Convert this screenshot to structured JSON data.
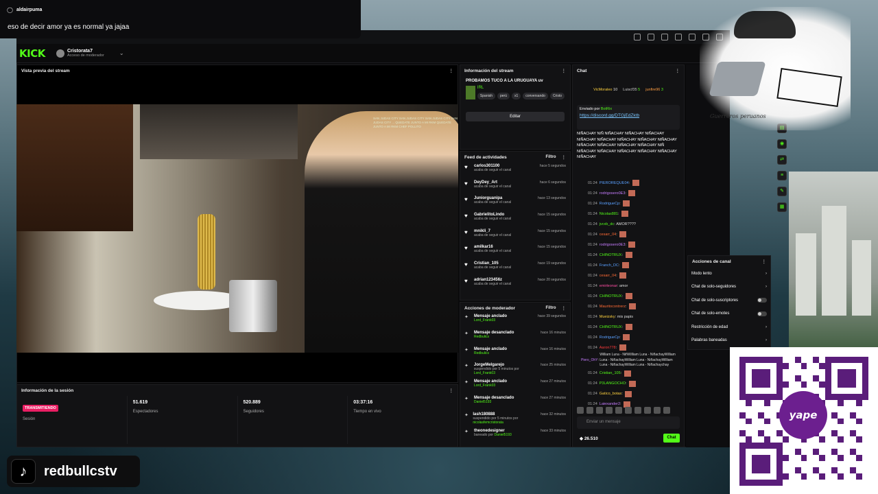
{
  "notification": {
    "username": "aldairpuma",
    "message": "eso de decir amor ya es normal ya jajaa"
  },
  "header": {
    "logo": "KICK",
    "channel_name": "Cristorata7",
    "channel_role": "Acceso de moderador"
  },
  "preview": {
    "title": "Vista previa del stream",
    "overlay_text": "SAN JUDAS CITY SAN JUDAS CITY SAN JUDAS CITY SAN JUDAS CITY ... QUEDATE JUNTO A MI RKM QUEDATE JUNTO A MI RKM CHEF POLLITO"
  },
  "session": {
    "title": "Información de la sesión",
    "cells": [
      {
        "value": "TRANSMITIENDO",
        "label": "Sesión"
      },
      {
        "value": "51.619",
        "label": "Espectadores"
      },
      {
        "value": "520.889",
        "label": "Seguidores"
      },
      {
        "value": "03:37:16",
        "label": "Tiempo en vivo"
      }
    ]
  },
  "stream_info": {
    "title": "Información del stream",
    "stream_title": "PROBAMOS TUCO A LA URUGUAYA uv",
    "category": "IRL",
    "tags": [
      "Spanish",
      "perú",
      "x1",
      "conversando",
      "Cristo"
    ],
    "edit_label": "Editar"
  },
  "feed": {
    "title": "Feed de actividades",
    "filter_label": "Filtro",
    "items": [
      {
        "name": "carlos301100",
        "action": "acaba de seguir el canal",
        "time": "hace 5 segundos"
      },
      {
        "name": "DeyDey_Art",
        "action": "acaba de seguir el canal",
        "time": "hace 6 segundos"
      },
      {
        "name": "Juniorguanipa",
        "action": "acaba de seguir el canal",
        "time": "hace 13 segundos"
      },
      {
        "name": "GabrielitoLindo",
        "action": "acaba de seguir el canal",
        "time": "hace 15 segundos"
      },
      {
        "name": "mnikli_7",
        "action": "acaba de seguir el canal",
        "time": "hace 15 segundos"
      },
      {
        "name": "amilkar16",
        "action": "acaba de seguir el canal",
        "time": "hace 15 segundos"
      },
      {
        "name": "Cristian_105",
        "action": "acaba de seguir el canal",
        "time": "hace 19 segundos"
      },
      {
        "name": "adrian123456z",
        "action": "acaba de seguir el canal",
        "time": "hace 20 segundos"
      }
    ]
  },
  "mod_actions": {
    "title": "Acciones de moderador",
    "filter_label": "Filtro",
    "items": [
      {
        "action": "Mensaje anclado",
        "by": "Lord_Frank03",
        "prefix": "",
        "time": "hace 39 segundos"
      },
      {
        "action": "Mensaje desanclado",
        "by": "Redbulics",
        "prefix": "",
        "time": "hace 16 minutos"
      },
      {
        "action": "Mensaje anclado",
        "by": "Redbulics",
        "prefix": "",
        "time": "hace 16 minutos"
      },
      {
        "action": "JorgeMelgarejo",
        "by": "Lord_Frank03",
        "prefix": "suspendido por 5 minutos por ",
        "time": "hace 25 minutos"
      },
      {
        "action": "Mensaje anclado",
        "by": "Lord_Frank03",
        "prefix": "",
        "time": "hace 27 minutos"
      },
      {
        "action": "Mensaje desanclado",
        "by": "Daniel5193",
        "prefix": "",
        "time": "hace 27 minutos"
      },
      {
        "action": "lash180888",
        "by": "nicolasfemcristorata",
        "prefix": "suspendido por 5 minutos por ",
        "time": "hace 32 minutos"
      },
      {
        "action": "theonedesigner",
        "by": "Daniel5193",
        "prefix": "baneado por ",
        "time": "hace 33 minutos"
      }
    ]
  },
  "chat": {
    "title": "Chat",
    "top_users": [
      {
        "name": "VicMoraleo",
        "count": "10"
      },
      {
        "name": "Luiscf35",
        "count": "5"
      },
      {
        "name": "junfire96",
        "count": "3"
      }
    ],
    "pinned_by": "Enviado por",
    "pinned_user": "BotRix",
    "pinned_link": "https://discord.gg/DTGjEdZktb",
    "spam_text": "NIÑACHAY NIÑ NIÑACHAY NIÑACHAY NIÑACHAY NIÑACHAY NIÑACHAY NIÑACHAY NIÑACHAY NIÑACHAY NIÑACHAY NIÑACHAY NIÑACHAY NIÑACHAY NIÑ NIÑACHAY NIÑACHAY NIÑACHAY NIÑACHAY NIÑACHAY NIÑACHAY",
    "messages": [
      {
        "time": "01:24",
        "user": "PIEROREQUE04",
        "color": "#5aa0ff",
        "text": ""
      },
      {
        "time": "01:24",
        "user": "rodrigosero0E3",
        "color": "#c77dff",
        "text": ""
      },
      {
        "time": "01:24",
        "user": "RodrigueCp",
        "color": "#5aa0ff",
        "text": ""
      },
      {
        "time": "01:24",
        "user": "Nicolas881",
        "color": "#53fc18",
        "text": ""
      },
      {
        "time": "01:24",
        "user": "jvcxb_dc",
        "color": "#53fc18",
        "text": "AMOR????"
      },
      {
        "time": "01:24",
        "user": "cesarr_04",
        "color": "#ff6b35",
        "text": ""
      },
      {
        "time": "01:24",
        "user": "rodrigosero0E3",
        "color": "#c77dff",
        "text": ""
      },
      {
        "time": "01:24",
        "user": "CHINOTRUX",
        "color": "#53fc18",
        "text": ""
      },
      {
        "time": "01:24",
        "user": "Franch_DC",
        "color": "#5aa0ff",
        "text": ""
      },
      {
        "time": "01:24",
        "user": "cesarr_04",
        "color": "#ff6b35",
        "text": ""
      },
      {
        "time": "01:24",
        "user": "emirleonar",
        "color": "#ff4fa3",
        "text": "amor"
      },
      {
        "time": "01:24",
        "user": "CHINOTRUX",
        "color": "#53fc18",
        "text": ""
      },
      {
        "time": "01:24",
        "user": "Mauritocontrerz",
        "color": "#ff6b35",
        "text": ""
      },
      {
        "time": "01:24",
        "user": "Mueizsky",
        "color": "#ffd23f",
        "text": "mis papis"
      },
      {
        "time": "01:24",
        "user": "CHINOTRUX",
        "color": "#53fc18",
        "text": ""
      },
      {
        "time": "01:24",
        "user": "RodrigueCp",
        "color": "#5aa0ff",
        "text": ""
      },
      {
        "time": "01:24",
        "user": "Aaron778",
        "color": "#ff3b3b",
        "text": ""
      }
    ],
    "long_message": "William Luna - NiñWilliam Luna - NiñachayWilliam Luna - NiñachayWilliam Luna - NiñachayWilliam Luna - NiñachayWilliam Luna - Niñachaychay",
    "long_user": "Piero_OhY",
    "bottom_messages": [
      {
        "time": "01:24",
        "user": "Cristian_105",
        "color": "#53fc18",
        "text": ""
      },
      {
        "time": "01:24",
        "user": "P3LANGOCHO",
        "color": "#53fc18",
        "text": ""
      },
      {
        "time": "01:24",
        "user": "Gatico_botas",
        "color": "#ffd23f",
        "text": ""
      },
      {
        "time": "01:24",
        "user": "Laiexander2",
        "color": "#c77dff",
        "text": ""
      }
    ],
    "input_placeholder": "Enviar un mensaje",
    "points": "26.510",
    "send_label": "Chat"
  },
  "channel_actions": {
    "title": "Acciones de canal",
    "items": [
      {
        "label": "Modo lento",
        "kind": "chevron"
      },
      {
        "label": "Chat de solo-seguidores",
        "kind": "chevron"
      },
      {
        "label": "Chat de solo-suscriptores",
        "kind": "toggle"
      },
      {
        "label": "Chat de solo-emotes",
        "kind": "toggle"
      },
      {
        "label": "Restricción de edad",
        "kind": "chevron"
      },
      {
        "label": "Palabras baneadas",
        "kind": "chevron"
      }
    ]
  },
  "overlay": {
    "signature": "Guerreros peruanos",
    "qr_brand": "yape",
    "tiktok_handle": "redbullcstv"
  },
  "colors": {
    "accent": "#53fc18",
    "live": "#e91e63"
  }
}
